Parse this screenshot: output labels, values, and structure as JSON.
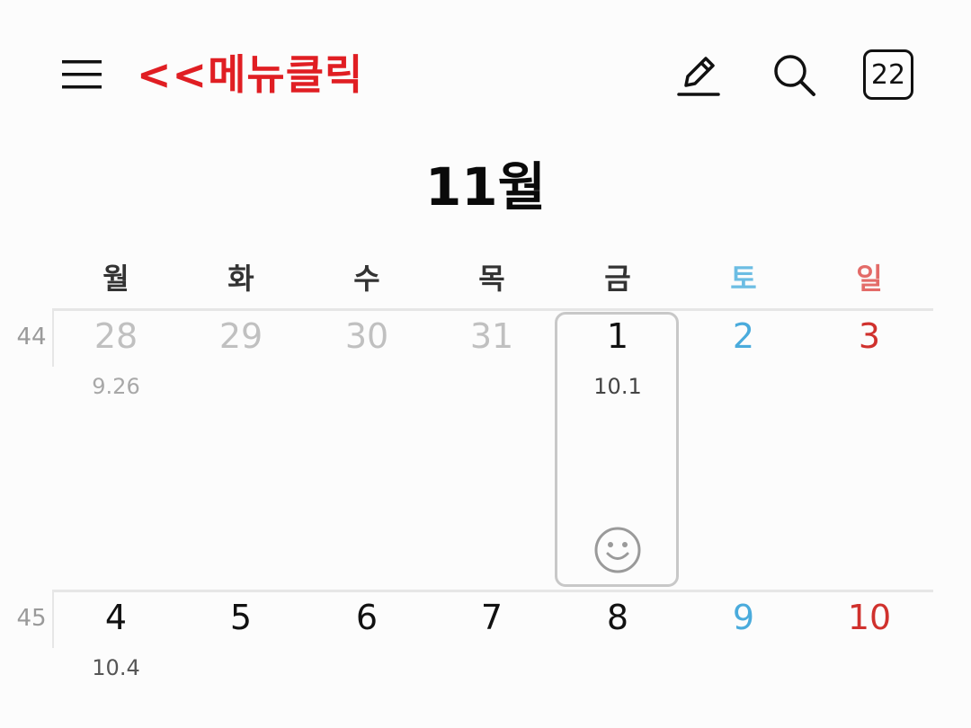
{
  "header": {
    "annotation_text": "<<메뉴클릭",
    "today_button_label": "22",
    "icons": {
      "menu": "hamburger-menu-icon",
      "edit": "pencil-edit-icon",
      "search": "search-icon"
    }
  },
  "month_title": "11월",
  "weekdays": [
    "월",
    "화",
    "수",
    "목",
    "금",
    "토",
    "일"
  ],
  "colors": {
    "saturday": "#4aabdc",
    "sunday": "#d0312d",
    "annotation": "#e01e23",
    "muted": "#c0c0c0"
  },
  "weeks": [
    {
      "week_number": "44",
      "days": [
        {
          "day": "28",
          "lunar": "9.26",
          "type": "muted"
        },
        {
          "day": "29",
          "lunar": "",
          "type": "muted"
        },
        {
          "day": "30",
          "lunar": "",
          "type": "muted"
        },
        {
          "day": "31",
          "lunar": "",
          "type": "muted"
        },
        {
          "day": "1",
          "lunar": "10.1",
          "type": "normal",
          "selected": true,
          "sticker": "smiley-face-icon"
        },
        {
          "day": "2",
          "lunar": "",
          "type": "saturday"
        },
        {
          "day": "3",
          "lunar": "",
          "type": "sunday"
        }
      ]
    },
    {
      "week_number": "45",
      "days": [
        {
          "day": "4",
          "lunar": "10.4",
          "type": "normal"
        },
        {
          "day": "5",
          "lunar": "",
          "type": "normal"
        },
        {
          "day": "6",
          "lunar": "",
          "type": "normal"
        },
        {
          "day": "7",
          "lunar": "",
          "type": "normal"
        },
        {
          "day": "8",
          "lunar": "",
          "type": "normal"
        },
        {
          "day": "9",
          "lunar": "",
          "type": "saturday"
        },
        {
          "day": "10",
          "lunar": "",
          "type": "sunday"
        }
      ]
    }
  ]
}
